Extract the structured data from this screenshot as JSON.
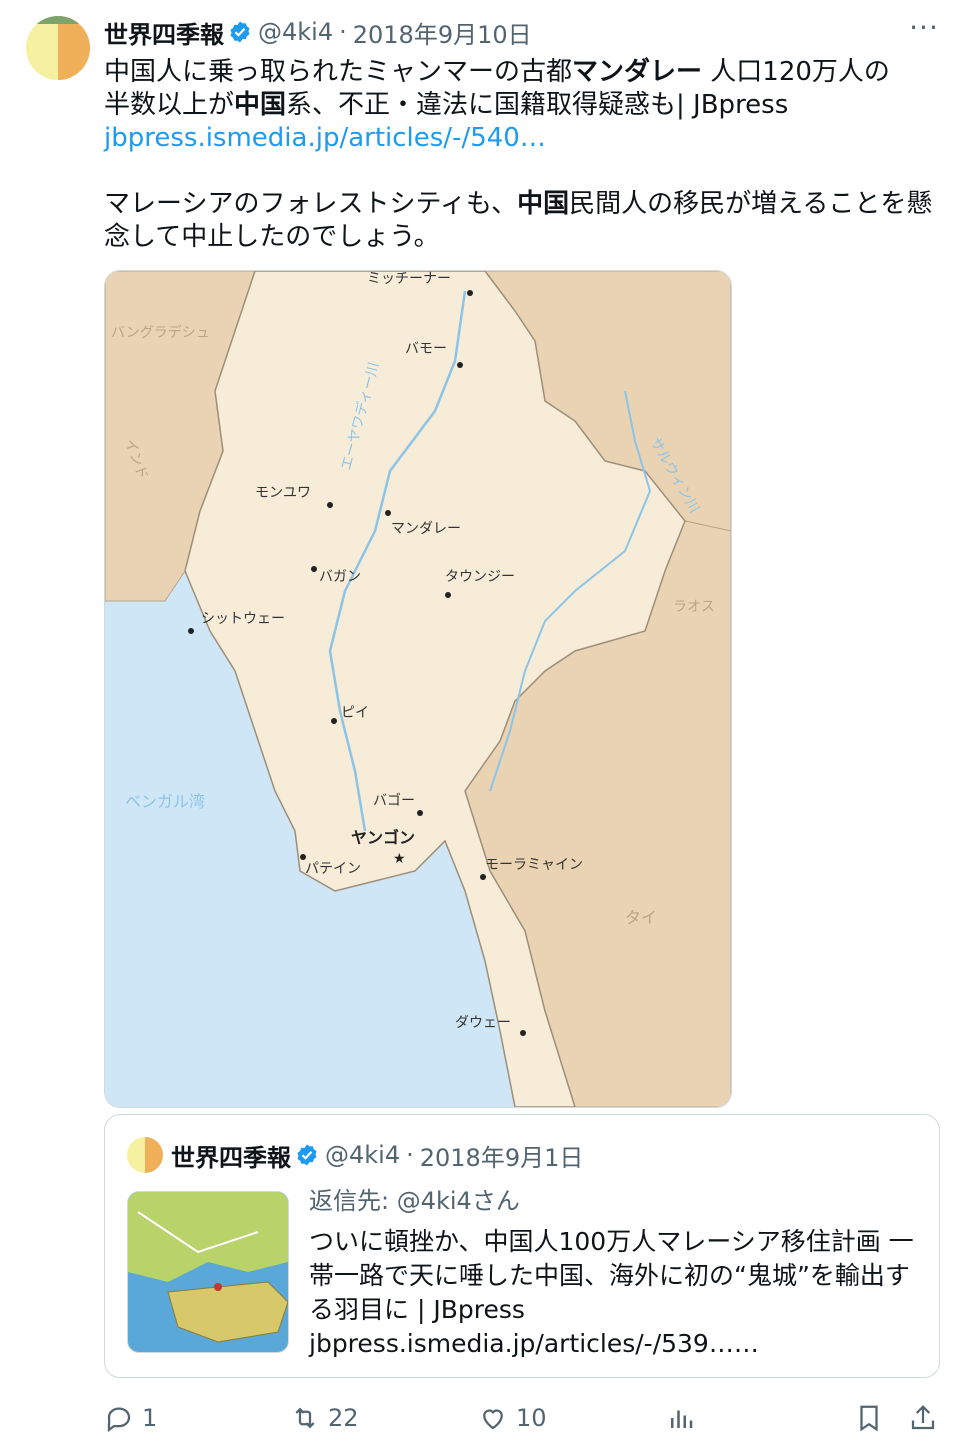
{
  "tweet": {
    "author_name": "世界四季報",
    "handle": "@4ki4",
    "separator": "·",
    "date": "2018年9月10日",
    "more_label": "···",
    "text_line1_a": "中国人に乗っ取られたミャンマーの古都",
    "text_line1_b": "マンダレー",
    "text_line1_c": " 人口120万人の",
    "text_line2_a": "半数以上が",
    "text_line2_b": "中国",
    "text_line2_c": "系、不正・違法に国籍取得疑惑も| JBpress",
    "link": "jbpress.ismedia.jp/articles/-/540…",
    "text_para2_a": "マレーシアのフォレストシティも、",
    "text_para2_b": "中国",
    "text_para2_c": "民間人の移民が増えることを懸念して中止したのでしょう。"
  },
  "map": {
    "labels": {
      "myitkyina": "ミッチーナー",
      "bhamo": "バモー",
      "bangladesh": "バングラデシュ",
      "india": "インド",
      "irrawaddy": "エーヤワディー川",
      "salween": "サルウィン川",
      "monywa": "モンユワ",
      "mandalay": "マンダレー",
      "bagan": "バガン",
      "taunggyi": "タウンジー",
      "sittwe": "シットウェー",
      "laos": "ラオス",
      "pyay": "ピイ",
      "bay": "ベンガル湾",
      "bago": "バゴー",
      "yangon": "ヤンゴン",
      "pathein": "パテイン",
      "mawlamyine": "モーラミャイン",
      "thailand": "タイ",
      "dawei": "ダウェー"
    },
    "colors": {
      "sea": "#cfe6f6",
      "myanmar": "#f7ecd8",
      "neighbors": "#e9d3b3",
      "river": "#8cc4e8"
    }
  },
  "quote": {
    "author_name": "世界四季報",
    "handle": "@4ki4",
    "separator": "·",
    "date": "2018年9月1日",
    "reply_to": "返信先: @4ki4さん",
    "text": "ついに頓挫か、中国人100万人マレーシア移住計画 一帯一路で天に唾した中国、海外に初の“鬼城”を輸出する羽目に | JBpress jbpress.ismedia.jp/articles/-/539……"
  },
  "actions": {
    "reply_count": "1",
    "retweet_count": "22",
    "like_count": "10"
  },
  "icons": [
    "verified-badge-icon",
    "more-icon",
    "reply-icon",
    "retweet-icon",
    "like-icon",
    "views-icon",
    "bookmark-icon",
    "share-icon"
  ],
  "accent_color": "#1d9bf0"
}
